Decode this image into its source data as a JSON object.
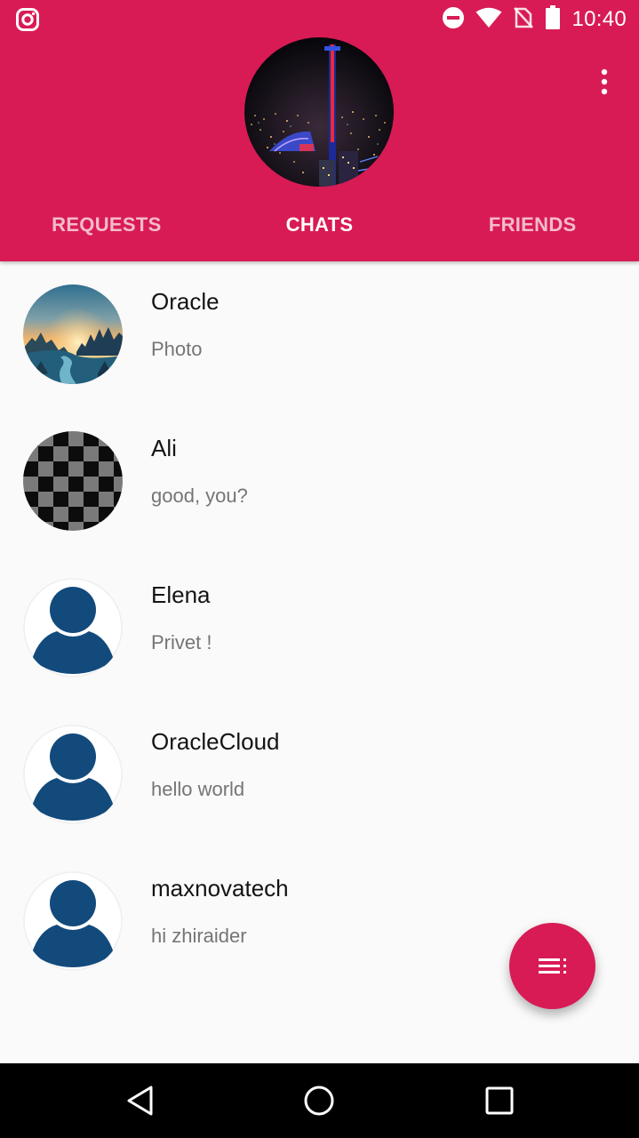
{
  "status_bar": {
    "time": "10:40",
    "icons": [
      "instagram-icon",
      "do-not-disturb-icon",
      "wifi-icon",
      "no-sim-icon",
      "battery-icon"
    ]
  },
  "header": {
    "profile_image": "city-night-tower-photo",
    "menu_icon": "more-vert-icon"
  },
  "tabs": [
    {
      "label": "REQUESTS",
      "active": false
    },
    {
      "label": "CHATS",
      "active": true
    },
    {
      "label": "FRIENDS",
      "active": false
    }
  ],
  "chats": [
    {
      "name": "Oracle",
      "preview": "Photo",
      "avatar": "landscape-photo"
    },
    {
      "name": "Ali",
      "preview": "good, you?",
      "avatar": "checkerboard-pattern"
    },
    {
      "name": "Elena",
      "preview": "Privet !",
      "avatar": "default-user"
    },
    {
      "name": "OracleCloud",
      "preview": "hello world",
      "avatar": "default-user"
    },
    {
      "name": "maxnovatech",
      "preview": "hi zhiraider",
      "avatar": "default-user"
    }
  ],
  "fab": {
    "icon": "playlist-icon"
  },
  "nav_bar": {
    "icons": [
      "back-icon",
      "home-icon",
      "recents-icon"
    ]
  },
  "colors": {
    "primary": "#d81b55",
    "avatar_blue": "#134a7c",
    "background": "#fafafa",
    "secondary_text": "#757575"
  }
}
